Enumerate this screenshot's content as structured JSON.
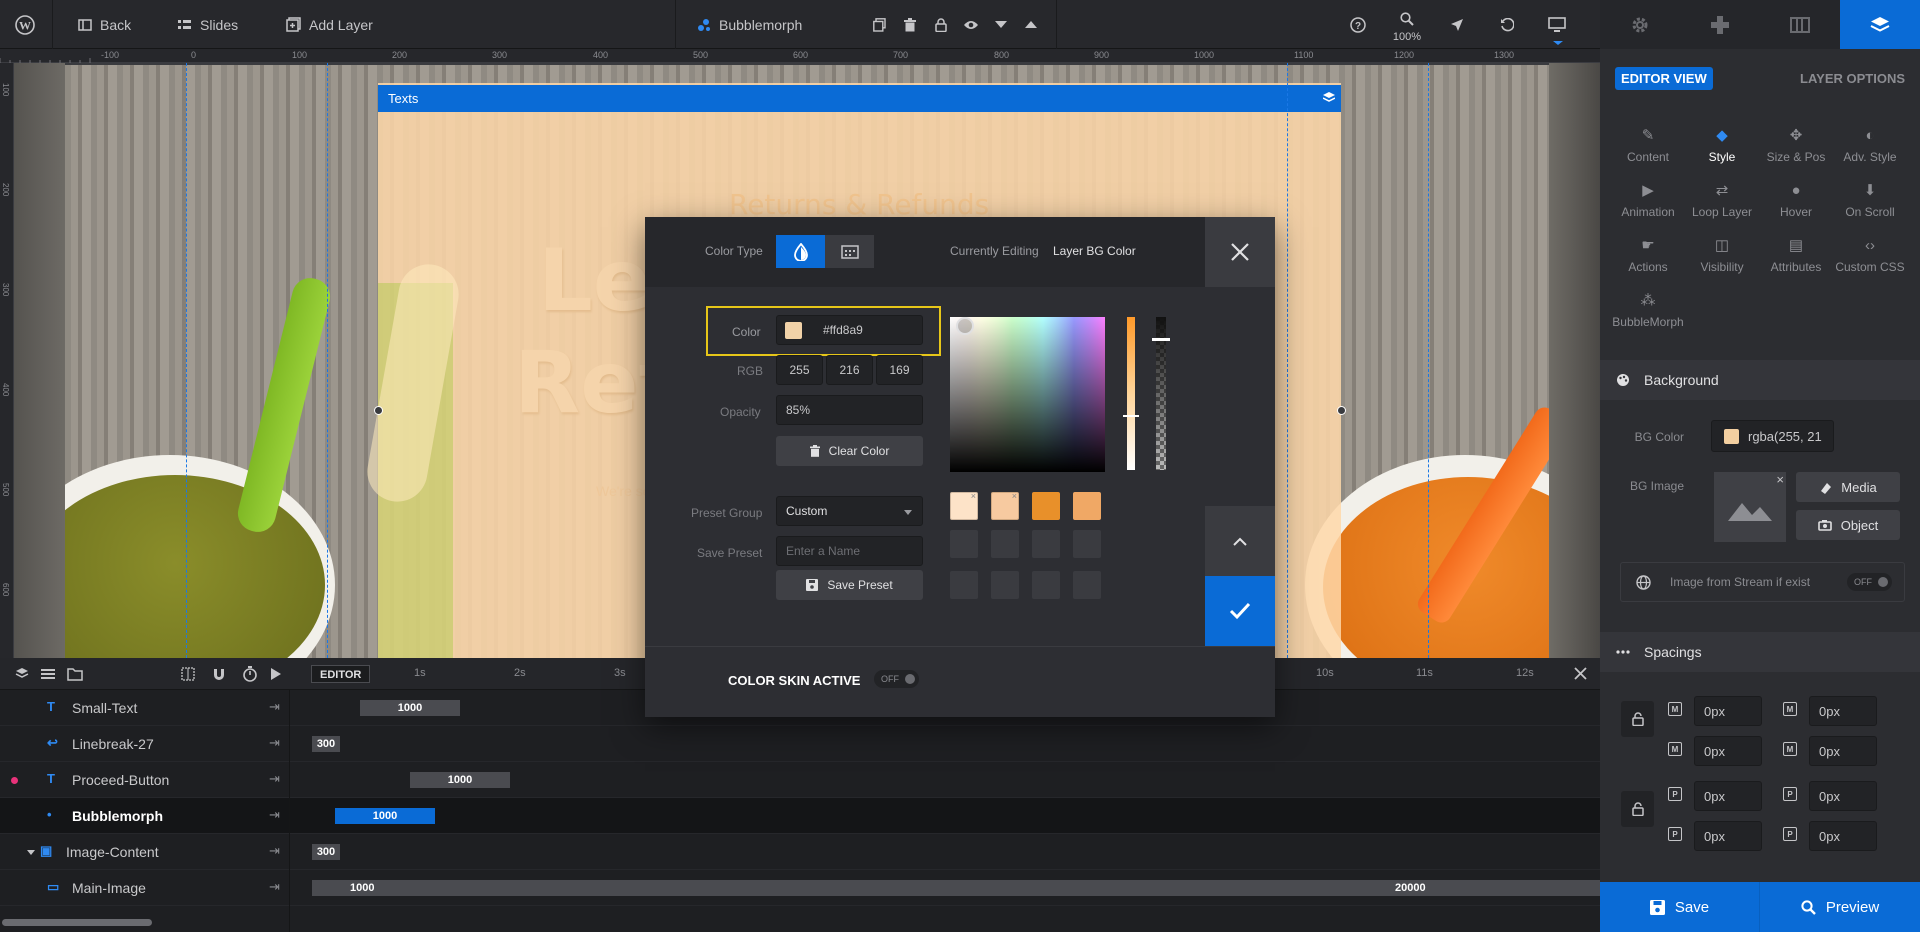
{
  "topbar": {
    "back_label": "Back",
    "slides_label": "Slides",
    "add_layer_label": "Add Layer",
    "layer_name": "Bubblemorph",
    "zoom": "100%"
  },
  "ruler": {
    "top_ticks": [
      "-100",
      "0",
      "100",
      "200",
      "300",
      "400",
      "500",
      "600",
      "700",
      "800",
      "900",
      "1000",
      "1100",
      "1200",
      "1300"
    ],
    "left_ticks": [
      "100",
      "200",
      "300",
      "400",
      "500",
      "600"
    ]
  },
  "slide": {
    "layer_title": "Texts",
    "heading": "Returns & Refunds",
    "big_line1": "Let'",
    "big_line2": "Retu",
    "small_text": "We're sorry y"
  },
  "color_picker": {
    "color_type_label": "Color Type",
    "currently_editing_label": "Currently Editing",
    "currently_editing_value": "Layer BG Color",
    "color_label": "Color",
    "hex": "#ffd8a9",
    "rgb_label": "RGB",
    "r": "255",
    "g": "216",
    "b": "169",
    "opacity_label": "Opacity",
    "opacity": "85%",
    "clear_label": "Clear Color",
    "preset_group_label": "Preset Group",
    "preset_group": "Custom",
    "save_preset_label": "Save Preset",
    "preset_placeholder": "Enter a Name",
    "save_preset_btn": "Save Preset",
    "skin_label": "COLOR SKIN ACTIVE",
    "skin_state": "OFF",
    "presets": [
      "#fde3c8",
      "#f7caa0",
      "#e8902a",
      "#f0a865"
    ]
  },
  "timeline": {
    "editor_label": "EDITOR",
    "seconds": [
      "1s",
      "2s",
      "3s",
      "10s",
      "11s",
      "12s"
    ],
    "rows": [
      {
        "name": "Small-Text",
        "bar": "1000"
      },
      {
        "name": "Linebreak-27",
        "bar": "300"
      },
      {
        "name": "Proceed-Button",
        "bar": "1000"
      },
      {
        "name": "Bubblemorph",
        "bar": "1000"
      },
      {
        "name": "Image-Content",
        "bar": "300"
      },
      {
        "name": "Main-Image",
        "bar": "1000",
        "bar_end": "20000"
      }
    ]
  },
  "panel": {
    "editor_view": "EDITOR VIEW",
    "layer_options": "LAYER OPTIONS",
    "options": [
      "Content",
      "Style",
      "Size & Pos",
      "Adv. Style",
      "Animation",
      "Loop Layer",
      "Hover",
      "On Scroll",
      "Actions",
      "Visibility",
      "Attributes",
      "Custom CSS",
      "BubbleMorph"
    ],
    "background_title": "Background",
    "bg_color_label": "BG Color",
    "bg_color_value": "rgba(255, 21",
    "bg_image_label": "BG Image",
    "media_label": "Media",
    "object_label": "Object",
    "stream_label": "Image from Stream if exist",
    "stream_state": "OFF",
    "spacings_title": "Spacings",
    "margins": [
      "0px",
      "0px",
      "0px",
      "0px"
    ],
    "paddings": [
      "0px",
      "0px",
      "0px",
      "0px"
    ],
    "save_label": "Save",
    "preview_label": "Preview"
  },
  "colors": {
    "accent": "#0a6bd6",
    "highlight": "#e6c619"
  }
}
